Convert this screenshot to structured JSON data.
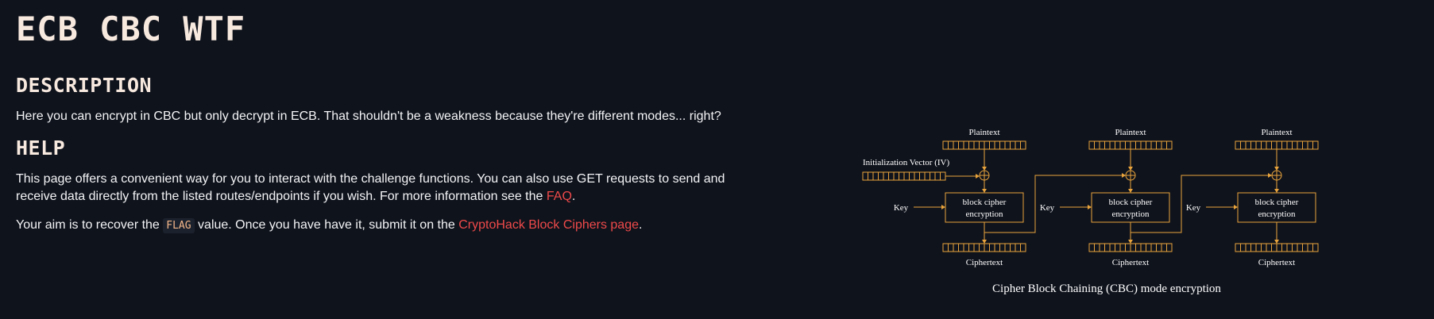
{
  "page": {
    "title": "ECB CBC WTF"
  },
  "description": {
    "heading": "DESCRIPTION",
    "text": "Here you can encrypt in CBC but only decrypt in ECB. That shouldn't be a weakness because they're different modes... right?"
  },
  "help": {
    "heading": "HELP",
    "text_before_link": "This page offers a convenient way for you to interact with the challenge functions. You can also use GET requests to send and receive data directly from the listed routes/endpoints if you wish. For more information see the ",
    "faq_link": "FAQ",
    "text_after_link": "."
  },
  "aim": {
    "text_before_code": "Your aim is to recover the ",
    "code": "FLAG",
    "text_middle": " value. Once you have have it, submit it on the ",
    "link": "CryptoHack Block Ciphers page",
    "text_end": "."
  },
  "diagram": {
    "plaintext_label": "Plaintext",
    "ciphertext_label": "Ciphertext",
    "iv_label": "Initialization Vector (IV)",
    "key_label": "Key",
    "block_line1": "block cipher",
    "block_line2": "encryption",
    "caption": "Cipher Block Chaining (CBC) mode encryption",
    "accent_color": "#e8a33c"
  }
}
